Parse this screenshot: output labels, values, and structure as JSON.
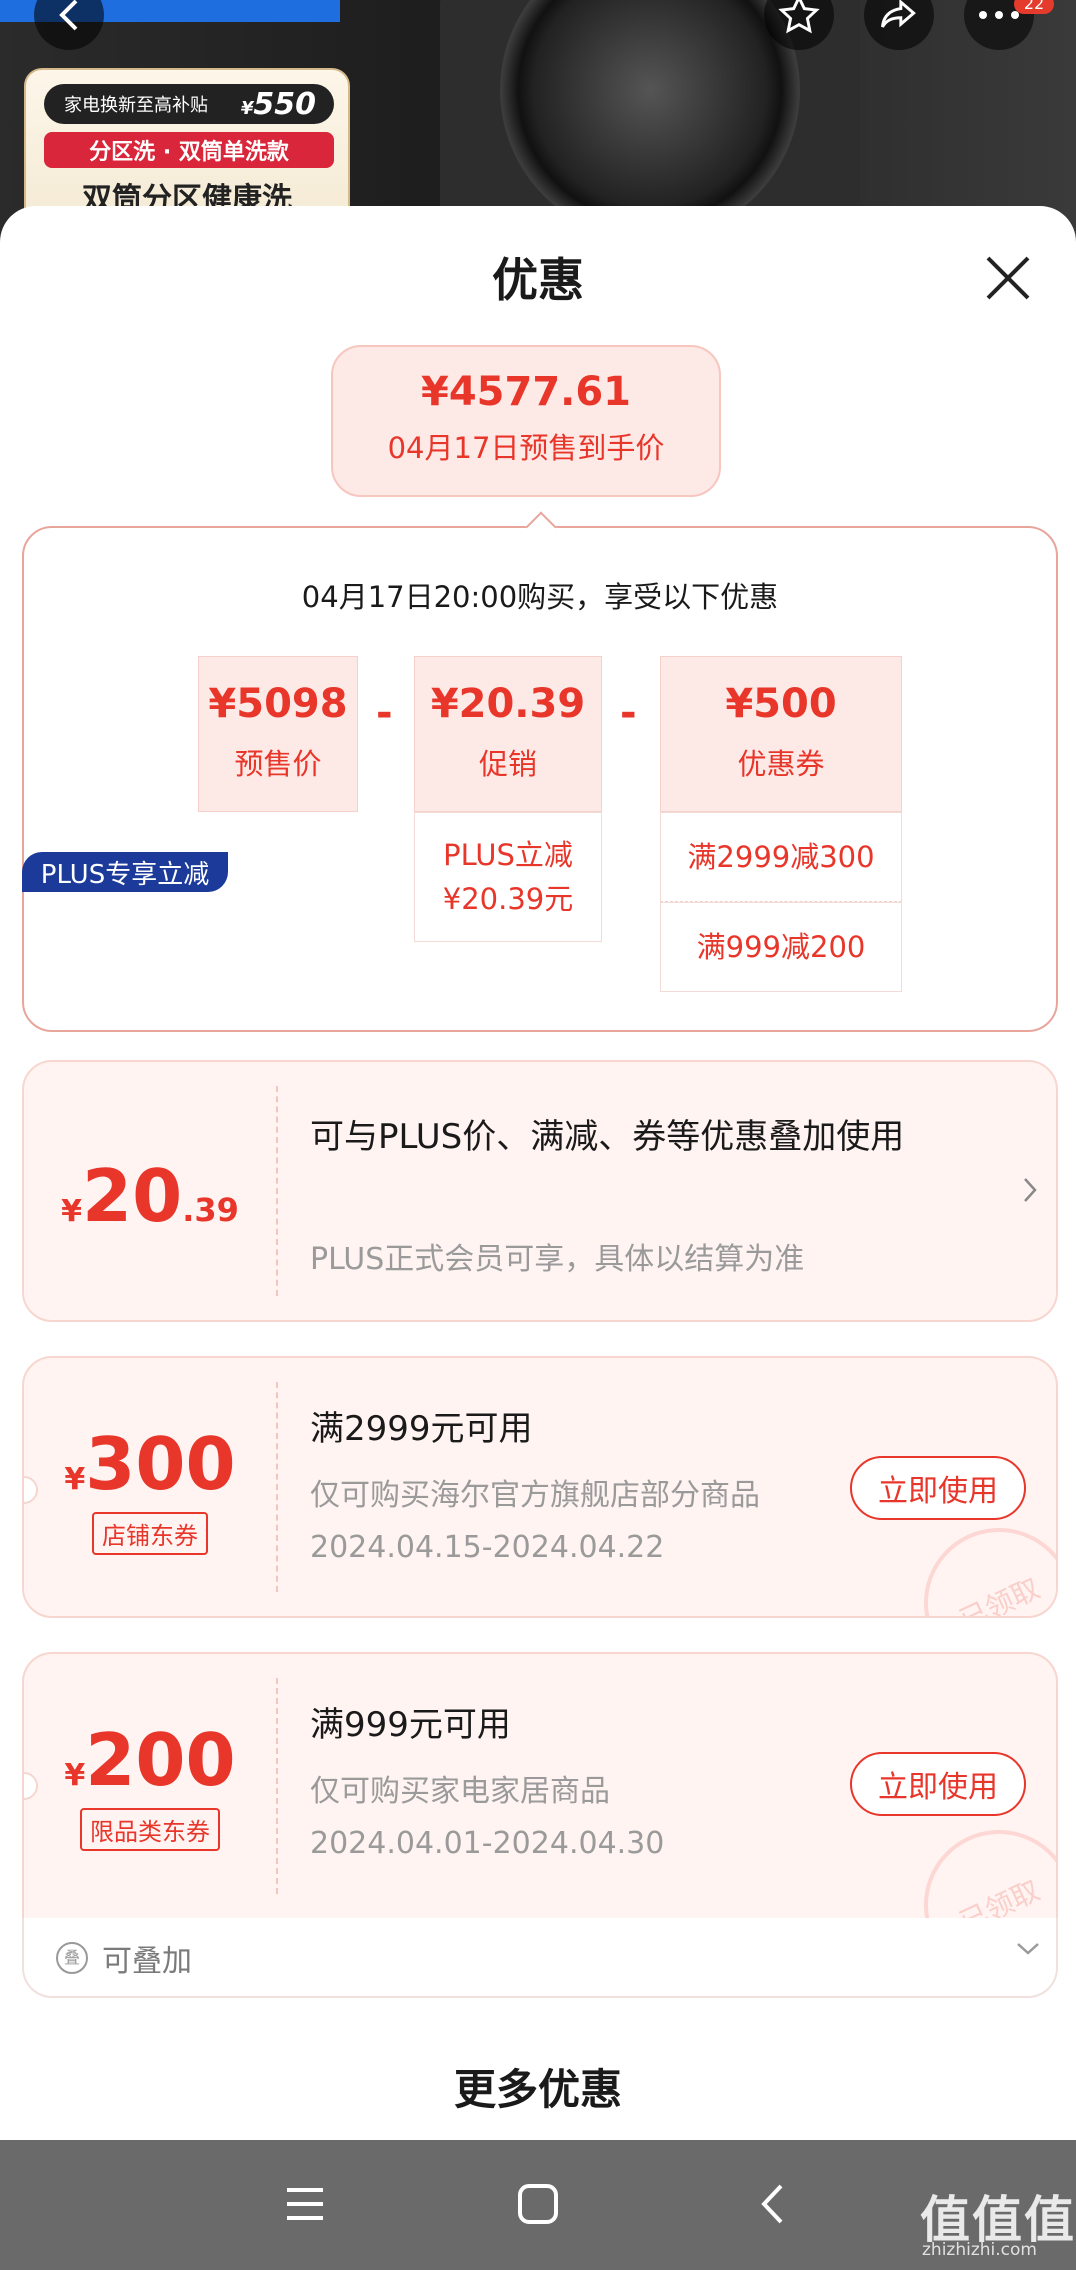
{
  "background": {
    "promo_subsidy_label": "家电换新至高补贴",
    "promo_subsidy_currency": "¥",
    "promo_subsidy_amount": "550",
    "promo_tagline": "分区洗 · 双筒单洗款",
    "promo_headline": "双筒分区健康洗",
    "badge_count": "22"
  },
  "sheet": {
    "title": "优惠",
    "final_price": "¥4577.61",
    "final_price_label": "04月17日预售到手价",
    "calc_heading": "04月17日20:00购买，享受以下优惠",
    "calc": [
      {
        "value": "¥5098",
        "label": "预售价"
      },
      {
        "value": "¥20.39",
        "label": "促销"
      },
      {
        "value": "¥500",
        "label": "优惠券"
      }
    ],
    "operator": "-",
    "promo_details": [
      "PLUS立减",
      "¥20.39元"
    ],
    "coupon_details": [
      "满2999减300",
      "满999减200"
    ]
  },
  "plus_coupon": {
    "tag": "PLUS专享立减",
    "currency": "¥",
    "amount_int": "20",
    "amount_dec": ".39",
    "title": "可与PLUS价、满减、券等优惠叠加使用",
    "desc": "PLUS正式会员可享，具体以结算为准"
  },
  "coupons": [
    {
      "currency": "¥",
      "amount": "300",
      "tag": "店铺东券",
      "title": "满2999元可用",
      "desc": "仅可购买海尔官方旗舰店部分商品",
      "date": "2024.04.15-2024.04.22",
      "button": "立即使用",
      "stamp": "已领取"
    },
    {
      "currency": "¥",
      "amount": "200",
      "tag": "限品类东券",
      "title": "满999元可用",
      "desc": "仅可购买家电家居商品",
      "date": "2024.04.01-2024.04.30",
      "button": "立即使用",
      "stamp": "已领取"
    }
  ],
  "stack": {
    "icon_char": "叠",
    "label": "可叠加"
  },
  "more": {
    "title": "更多优惠"
  },
  "watermark": {
    "text": "值值值",
    "sub": "zhizhizhi.com"
  }
}
